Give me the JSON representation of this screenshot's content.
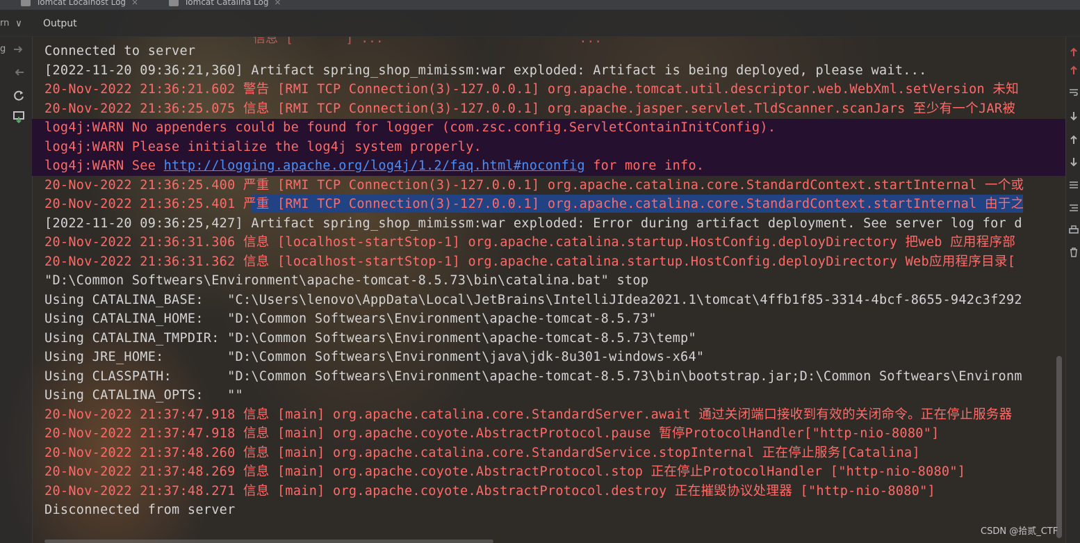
{
  "tabs": [
    {
      "label": "Tomcat Localhost Log",
      "close": "×"
    },
    {
      "label": "Tomcat Catalina Log",
      "close": "×"
    }
  ],
  "header": {
    "cut_text": "rn",
    "chevron": "∨",
    "output_label": "Output"
  },
  "gutter": {
    "cut_text": "g",
    "icons": [
      "arrow-right-icon",
      "arrow-split-icon",
      "rerun-icon",
      "save-output-icon"
    ]
  },
  "right_gutter": {
    "icons": [
      "scroll-up-icon",
      "scroll-up-red-icon",
      "soft-wrap-icon",
      "scroll-down-icon",
      "up-icon",
      "down-icon",
      "filter-icon",
      "align-icon",
      "print-icon",
      "trash-icon"
    ]
  },
  "console": {
    "cut_top": "信息 [       ] ...                          ...",
    "lines": [
      {
        "segments": [
          {
            "t": "Connected to server",
            "c": "white"
          }
        ]
      },
      {
        "segments": [
          {
            "t": "[2022-11-20 09:36:21,360] Artifact spring_shop_mimissm:war exploded: Artifact is being deployed, please wait...",
            "c": "white"
          }
        ]
      },
      {
        "segments": [
          {
            "t": "20-Nov-2022 21:36:21.602 警告 [RMI TCP Connection(3)-127.0.0.1] org.apache.tomcat.util.descriptor.web.WebXml.setVersion 未知",
            "c": "red"
          }
        ]
      },
      {
        "segments": [
          {
            "t": "20-Nov-2022 21:36:25.075 信息 [RMI TCP Connection(3)-127.0.0.1] org.apache.jasper.servlet.TldScanner.scanJars 至少有一个JAR被",
            "c": "red"
          }
        ]
      },
      {
        "segments": [
          {
            "t": "log4j:WARN No appenders could be found for logger (com.zsc.config.ServletContainInitConfig).",
            "c": "red"
          }
        ]
      },
      {
        "segments": [
          {
            "t": "log4j:WARN Please initialize the log4j system properly.",
            "c": "red"
          }
        ]
      },
      {
        "segments": [
          {
            "t": "log4j:WARN See ",
            "c": "red"
          },
          {
            "t": "http://logging.apache.org/log4j/1.2/faq.html#noconfig",
            "c": "link"
          },
          {
            "t": " for more info.",
            "c": "red"
          }
        ]
      },
      {
        "segments": [
          {
            "t": "20-Nov-2022 21:36:25.400 严重 [RMI TCP Connection(3)-127.0.0.1] org.apache.catalina.core.StandardContext.startInternal 一个或",
            "c": "red"
          }
        ]
      },
      {
        "segments": [
          {
            "t": "20-Nov-2022 21:36:25.401 严重 [RMI TCP Connection(3)-127.0.0.1] org.apache.catalina.core.StandardContext.startInternal 由于之",
            "c": "red"
          }
        ]
      },
      {
        "segments": [
          {
            "t": "[2022-11-20 09:36:25,427] Artifact spring_shop_mimissm:war exploded: Error during artifact deployment. See server log for d",
            "c": "white"
          }
        ]
      },
      {
        "segments": [
          {
            "t": "20-Nov-2022 21:36:31.306 信息 [localhost-startStop-1] org.apache.catalina.startup.HostConfig.deployDirectory 把web 应用程序部",
            "c": "red"
          }
        ]
      },
      {
        "segments": [
          {
            "t": "20-Nov-2022 21:36:31.362 信息 [localhost-startStop-1] org.apache.catalina.startup.HostConfig.deployDirectory Web应用程序目录[",
            "c": "red"
          }
        ]
      },
      {
        "segments": [
          {
            "t": "\"D:\\Common Softwears\\Environment\\apache-tomcat-8.5.73\\bin\\catalina.bat\" stop",
            "c": "white"
          }
        ]
      },
      {
        "segments": [
          {
            "t": "Using CATALINA_BASE:   \"C:\\Users\\lenovo\\AppData\\Local\\JetBrains\\IntelliJIdea2021.1\\tomcat\\4ffb1f85-3314-4bcf-8655-942c3f292",
            "c": "white"
          }
        ]
      },
      {
        "segments": [
          {
            "t": "Using CATALINA_HOME:   \"D:\\Common Softwears\\Environment\\apache-tomcat-8.5.73\"",
            "c": "white"
          }
        ]
      },
      {
        "segments": [
          {
            "t": "Using CATALINA_TMPDIR: \"D:\\Common Softwears\\Environment\\apache-tomcat-8.5.73\\temp\"",
            "c": "white"
          }
        ]
      },
      {
        "segments": [
          {
            "t": "Using JRE_HOME:        \"D:\\Common Softwears\\Environment\\java\\jdk-8u301-windows-x64\"",
            "c": "white"
          }
        ]
      },
      {
        "segments": [
          {
            "t": "Using CLASSPATH:       \"D:\\Common Softwears\\Environment\\apache-tomcat-8.5.73\\bin\\bootstrap.jar;D:\\Common Softwears\\Environm",
            "c": "white"
          }
        ]
      },
      {
        "segments": [
          {
            "t": "Using CATALINA_OPTS:   \"\"",
            "c": "white"
          }
        ]
      },
      {
        "segments": [
          {
            "t": "20-Nov-2022 21:37:47.918 信息 [main] org.apache.catalina.core.StandardServer.await 通过关闭端口接收到有效的关闭命令。正在停止服务器",
            "c": "red"
          }
        ]
      },
      {
        "segments": [
          {
            "t": "20-Nov-2022 21:37:47.918 信息 [main] org.apache.coyote.AbstractProtocol.pause 暂停ProtocolHandler[\"http-nio-8080\"]",
            "c": "red"
          }
        ]
      },
      {
        "segments": [
          {
            "t": "20-Nov-2022 21:37:48.260 信息 [main] org.apache.catalina.core.StandardService.stopInternal 正在停止服务[Catalina]",
            "c": "red"
          }
        ]
      },
      {
        "segments": [
          {
            "t": "20-Nov-2022 21:37:48.269 信息 [main] org.apache.coyote.AbstractProtocol.stop 正在停止ProtocolHandler [\"http-nio-8080\"]",
            "c": "red"
          }
        ]
      },
      {
        "segments": [
          {
            "t": "20-Nov-2022 21:37:48.271 信息 [main] org.apache.coyote.AbstractProtocol.destroy 正在摧毁协议处理器 [\"http-nio-8080\"]",
            "c": "red"
          }
        ]
      },
      {
        "segments": [
          {
            "t": "Disconnected from server",
            "c": "white"
          }
        ]
      }
    ]
  },
  "watermark": "CSDN @拾贰_CTF",
  "colors": {
    "white_text": "#d4d4d4",
    "red_text": "#ff6b68",
    "link": "#4a8ff5",
    "warn_band": "#25102f",
    "selection": "#214283"
  }
}
